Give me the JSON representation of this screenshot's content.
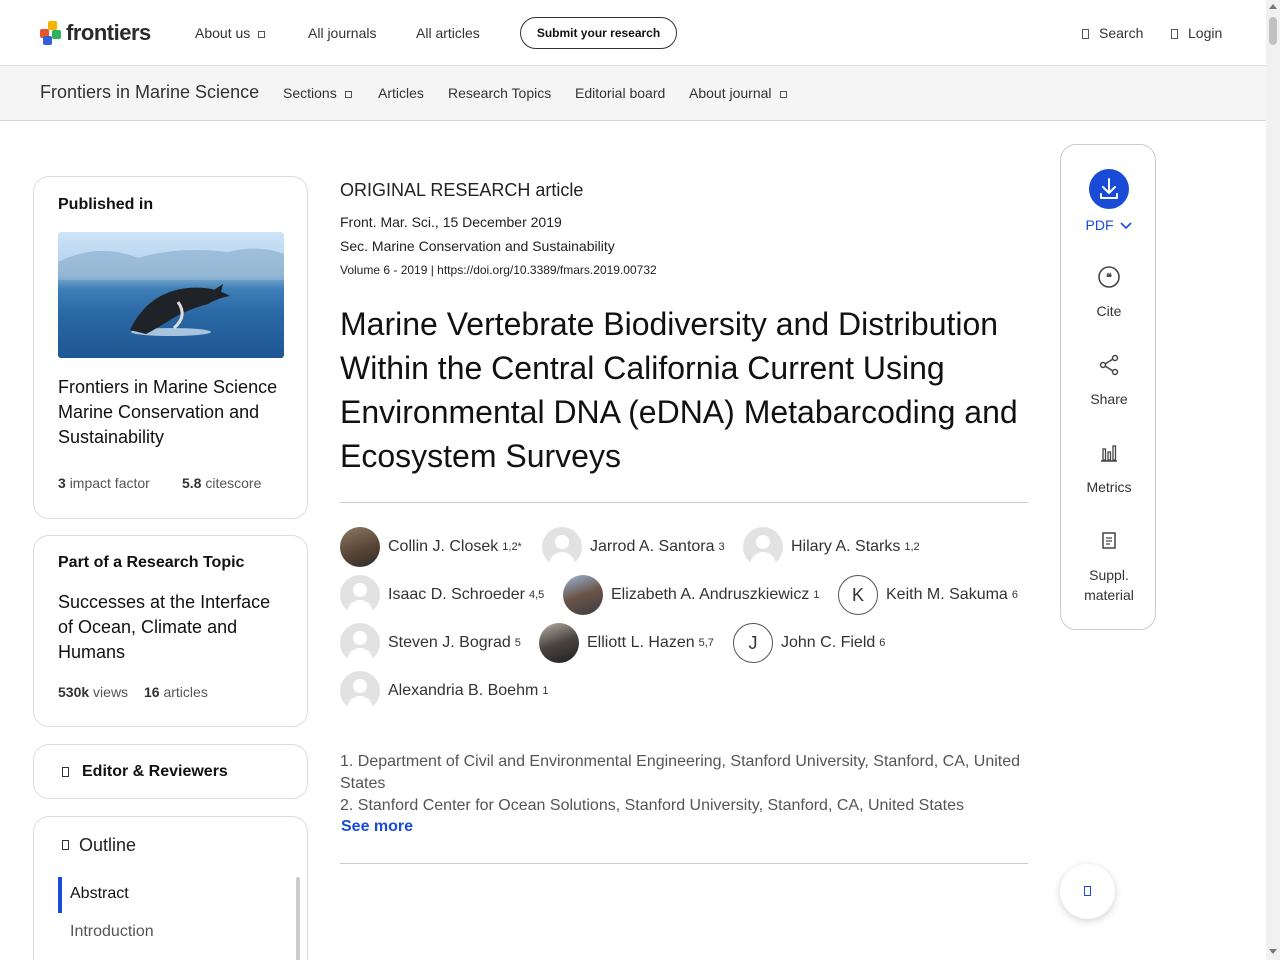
{
  "topnav": {
    "logo_text": "frontiers",
    "about_us": "About us",
    "all_journals": "All journals",
    "all_articles": "All articles",
    "submit": "Submit your research",
    "search": "Search",
    "login": "Login"
  },
  "journalbar": {
    "name": "Frontiers in Marine Science",
    "sections": "Sections",
    "articles": "Articles",
    "research_topics": "Research Topics",
    "editorial_board": "Editorial board",
    "about_journal": "About journal"
  },
  "published_in": {
    "title": "Published in",
    "journal_line1": "Frontiers in Marine Science",
    "journal_line2": "Marine Conservation and",
    "journal_line3": "Sustainability",
    "impact_value": "3",
    "impact_label": "impact factor",
    "citescore_value": "5.8",
    "citescore_label": "citescore"
  },
  "research_topic": {
    "title": "Part of a Research Topic",
    "line1": "Successes at the Interface",
    "line2": "of Ocean, Climate and",
    "line3": "Humans",
    "views_value": "530k",
    "views_label": "views",
    "articles_value": "16",
    "articles_label": "articles"
  },
  "editor_card": {
    "title": "Editor & Reviewers"
  },
  "outline": {
    "title": "Outline",
    "items": [
      "Abstract",
      "Introduction"
    ]
  },
  "article": {
    "type": "ORIGINAL RESEARCH article",
    "journal_date": "Front. Mar. Sci., 15 December 2019",
    "section": "Sec. Marine Conservation and Sustainability",
    "volume": "Volume 6 - 2019 | https://doi.org/10.3389/fmars.2019.00732",
    "title": "Marine Vertebrate Biodiversity and Distribution Within the Central California Current Using Environmental DNA (eDNA) Metabarcoding and Ecosystem Surveys"
  },
  "authors": [
    {
      "name": "Collin J. Closek",
      "sup": "1,2*"
    },
    {
      "name": "Jarrod A. Santora",
      "sup": "3"
    },
    {
      "name": "Hilary A. Starks",
      "sup": "1,2"
    },
    {
      "name": "Isaac D. Schroeder",
      "sup": "4,5"
    },
    {
      "name": "Elizabeth A. Andruszkiewicz",
      "sup": "1"
    },
    {
      "name": "Keith M. Sakuma",
      "sup": "6",
      "initial": "K"
    },
    {
      "name": "Steven J. Bograd",
      "sup": "5"
    },
    {
      "name": "Elliott L. Hazen",
      "sup": "5,7"
    },
    {
      "name": "John C. Field",
      "sup": "6",
      "initial": "J"
    },
    {
      "name": "Alexandria B. Boehm",
      "sup": "1"
    }
  ],
  "affiliations": {
    "a1": "1. Department of Civil and Environmental Engineering, Stanford University, Stanford, CA, United States",
    "a2": "2. Stanford Center for Ocean Solutions, Stanford University, Stanford, CA, United States",
    "see_more": "See more"
  },
  "actions": {
    "pdf": "PDF",
    "cite": "Cite",
    "share": "Share",
    "metrics": "Metrics",
    "suppl_line1": "Suppl.",
    "suppl_line2": "material"
  },
  "colors": {
    "accent": "#1a4bd6",
    "border": "#dddddd"
  }
}
